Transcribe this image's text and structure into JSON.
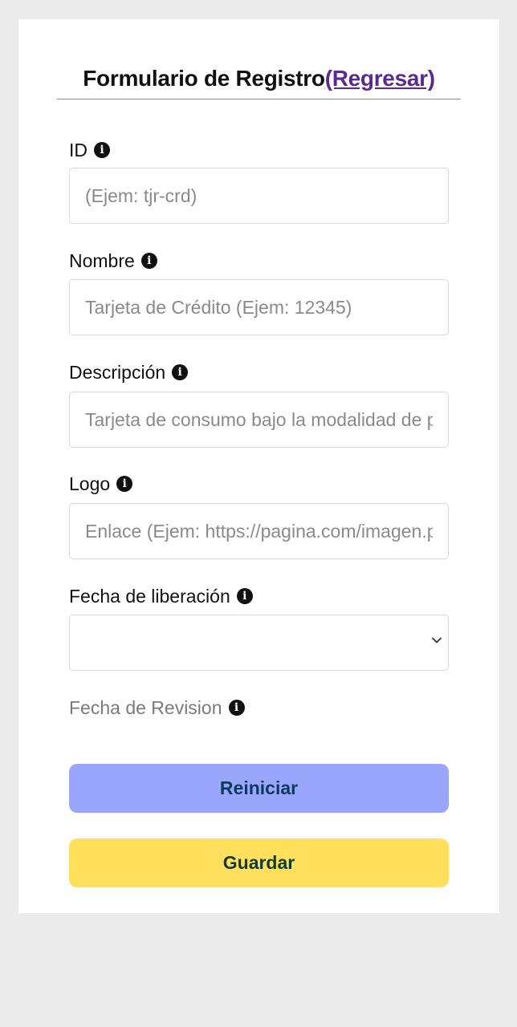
{
  "form": {
    "title": "Formulario de Registro",
    "back_link": "(Regresar)"
  },
  "fields": {
    "id": {
      "label": "ID",
      "placeholder": "(Ejem: tjr-crd)"
    },
    "nombre": {
      "label": "Nombre",
      "placeholder": "Tarjeta de Crédito (Ejem: 12345)"
    },
    "descripcion": {
      "label": "Descripción",
      "placeholder": "Tarjeta de consumo bajo la modalidad de pago diferido"
    },
    "logo": {
      "label": "Logo",
      "placeholder": "Enlace (Ejem: https://pagina.com/imagen.png)"
    },
    "fecha_liberacion": {
      "label": "Fecha de liberación",
      "value": ""
    },
    "fecha_revision": {
      "label": "Fecha de Revision"
    }
  },
  "icons": {
    "info": "info-circle-icon",
    "select_chevron": "chevron-down-icon"
  },
  "buttons": {
    "reset_label": "Reiniciar",
    "save_label": "Guardar"
  },
  "colors": {
    "background": "#ebebeb",
    "card": "#ffffff",
    "link": "#5b2a8e",
    "reset_button": "#99a6fc",
    "save_button": "#ffdf5b"
  }
}
